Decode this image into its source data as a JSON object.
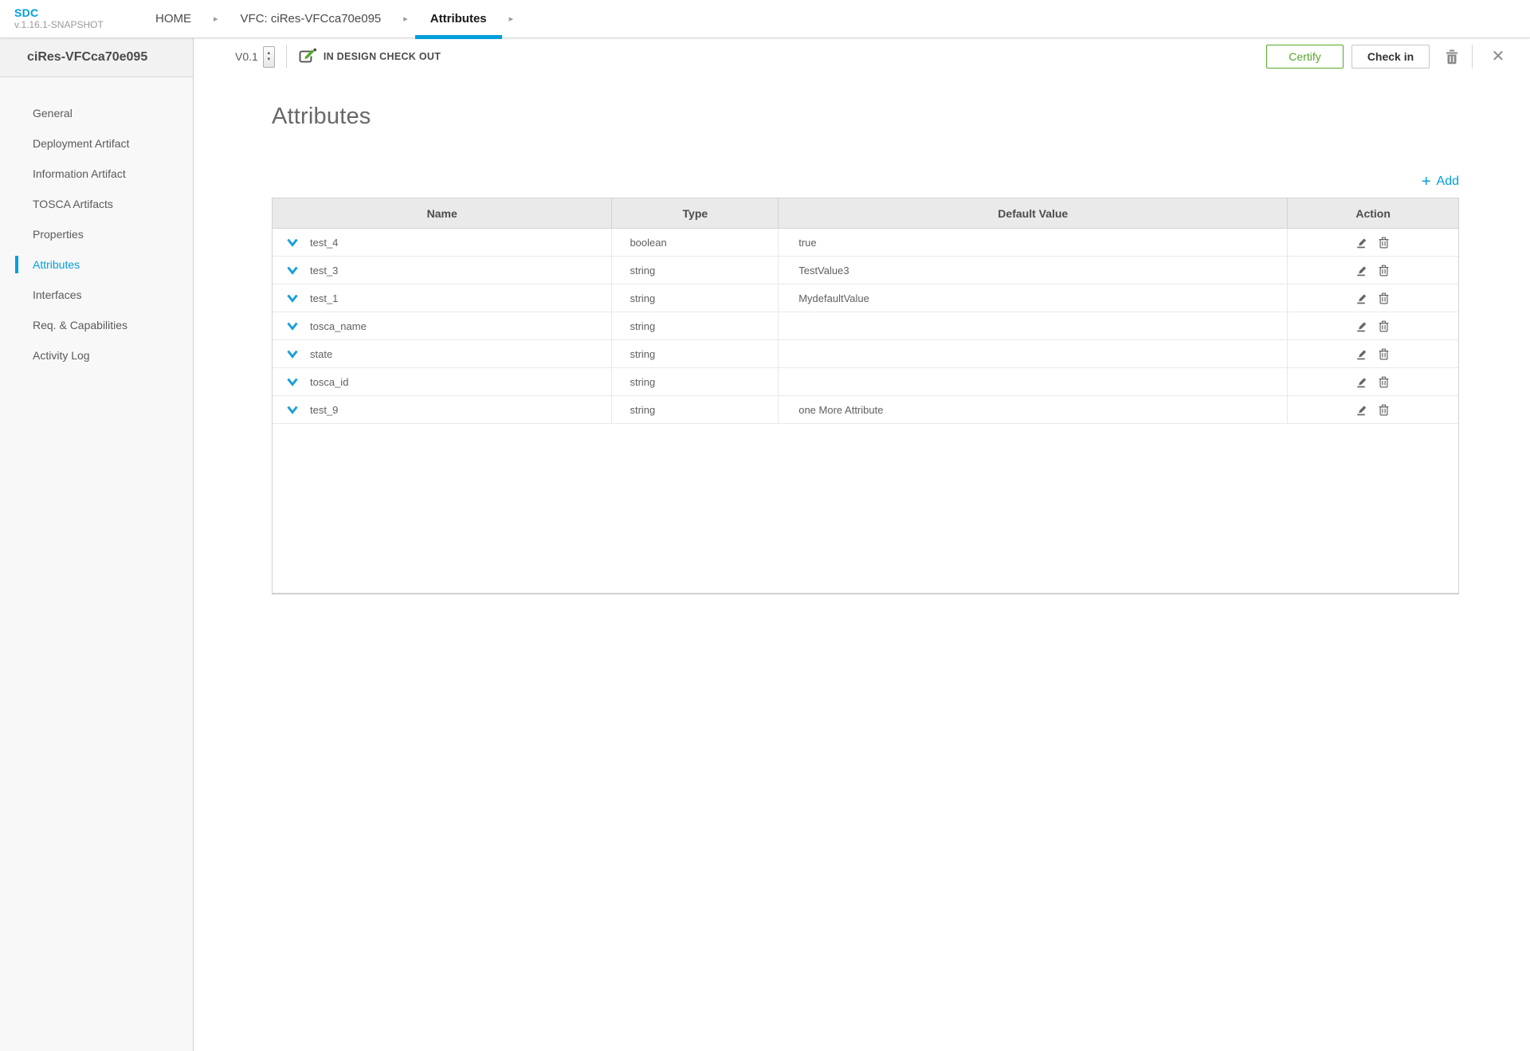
{
  "header": {
    "logo": {
      "title": "SDC",
      "version": "v.1.16.1-SNAPSHOT"
    },
    "breadcrumbs": [
      {
        "label": "HOME",
        "active": false
      },
      {
        "label": "VFC: ciRes-VFCca70e095",
        "active": false
      },
      {
        "label": "Attributes",
        "active": true
      }
    ]
  },
  "sidebar": {
    "title": "ciRes-VFCca70e095",
    "items": [
      {
        "label": "General",
        "active": false
      },
      {
        "label": "Deployment Artifact",
        "active": false
      },
      {
        "label": "Information Artifact",
        "active": false
      },
      {
        "label": "TOSCA Artifacts",
        "active": false
      },
      {
        "label": "Properties",
        "active": false
      },
      {
        "label": "Attributes",
        "active": true
      },
      {
        "label": "Interfaces",
        "active": false
      },
      {
        "label": "Req. & Capabilities",
        "active": false
      },
      {
        "label": "Activity Log",
        "active": false
      }
    ]
  },
  "toolbar": {
    "version": "V0.1",
    "status": "IN DESIGN CHECK OUT",
    "certify_label": "Certify",
    "checkin_label": "Check in"
  },
  "main": {
    "title": "Attributes",
    "add_plus": "+",
    "add_label": "Add",
    "table": {
      "columns": [
        "Name",
        "Type",
        "Default Value",
        "Action"
      ],
      "rows": [
        {
          "name": "test_4",
          "type": "boolean",
          "default": "true"
        },
        {
          "name": "test_3",
          "type": "string",
          "default": "TestValue3"
        },
        {
          "name": "test_1",
          "type": "string",
          "default": "MydefaultValue"
        },
        {
          "name": "tosca_name",
          "type": "string",
          "default": ""
        },
        {
          "name": "state",
          "type": "string",
          "default": ""
        },
        {
          "name": "tosca_id",
          "type": "string",
          "default": ""
        },
        {
          "name": "test_9",
          "type": "string",
          "default": "one More Attribute"
        }
      ]
    }
  },
  "icons": {
    "breadcrumb_arrow": "▸",
    "spinner_up": "▲",
    "spinner_down": "▼",
    "close": "✕"
  },
  "colors": {
    "accent_blue": "#009fdb",
    "certify_green": "#57a727",
    "header_bg": "#eaeaea",
    "sidebar_bg": "#f8f8f8"
  }
}
